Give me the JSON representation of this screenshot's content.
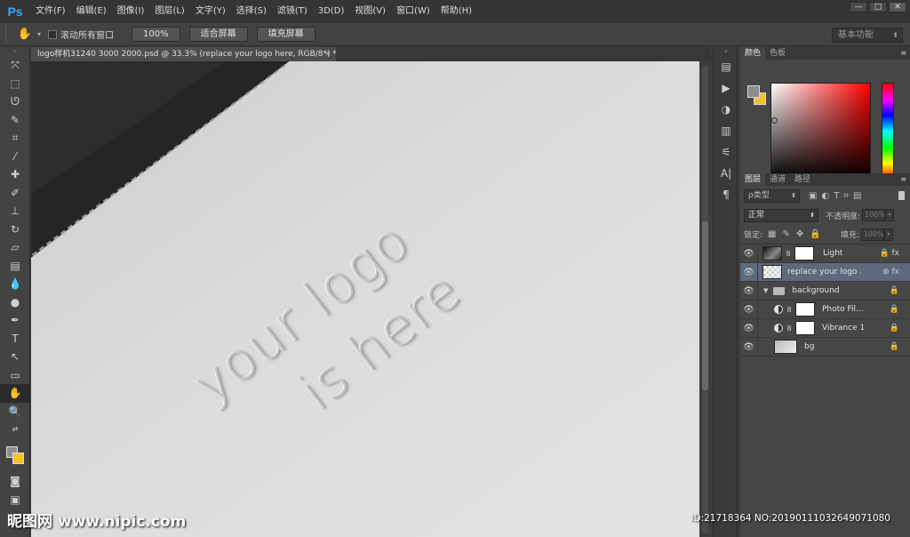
{
  "app": {
    "logo": "Ps"
  },
  "menu": [
    "文件(F)",
    "编辑(E)",
    "图像(I)",
    "图层(L)",
    "文字(Y)",
    "选择(S)",
    "滤镜(T)",
    "3D(D)",
    "视图(V)",
    "窗口(W)",
    "帮助(H)"
  ],
  "window_controls": {
    "minimize": "—",
    "restore": "□",
    "close": "✕"
  },
  "options_bar": {
    "scroll_all_label": "滚动所有窗口",
    "btn_100": "100%",
    "btn_fit": "适合屏幕",
    "btn_fill": "填充屏幕",
    "workspace": "基本功能"
  },
  "document_tab": {
    "title": "logo样机31240 3000 2000.psd @ 33.3% (replace your logo here, RGB/8*) *",
    "close": "×"
  },
  "canvas": {
    "line1": "your logo",
    "line2": "is here"
  },
  "panels": {
    "color_tabs": [
      "颜色",
      "色板"
    ],
    "layers_tabs": [
      "图层",
      "通道",
      "路径"
    ],
    "kind_filter": "ρ类型",
    "blend_mode": "正常",
    "opacity_label": "不透明度:",
    "opacity_value": "100%",
    "lock_label": "锁定:",
    "fill_label": "填充:",
    "fill_value": "100%"
  },
  "layers": [
    {
      "name": "Light",
      "status": "🔒 fx"
    },
    {
      "name": "replace your logo ...",
      "status": "⊛ fx"
    },
    {
      "name": "background",
      "status": "🔒"
    },
    {
      "name": "Photo Fil...",
      "status": "🔒"
    },
    {
      "name": "Vibrance 1",
      "status": "🔒"
    },
    {
      "name": "bg",
      "status": "🔒"
    }
  ],
  "watermark": {
    "left": "昵图网 www.nipic.com",
    "right": "ID:21718364 NO:20190111032649071080"
  },
  "colors": {
    "foreground": "#8c8c8c",
    "background": "#f2c22e",
    "accent_ps": "#31a8ff",
    "selected_layer": "#5d6a7d"
  }
}
